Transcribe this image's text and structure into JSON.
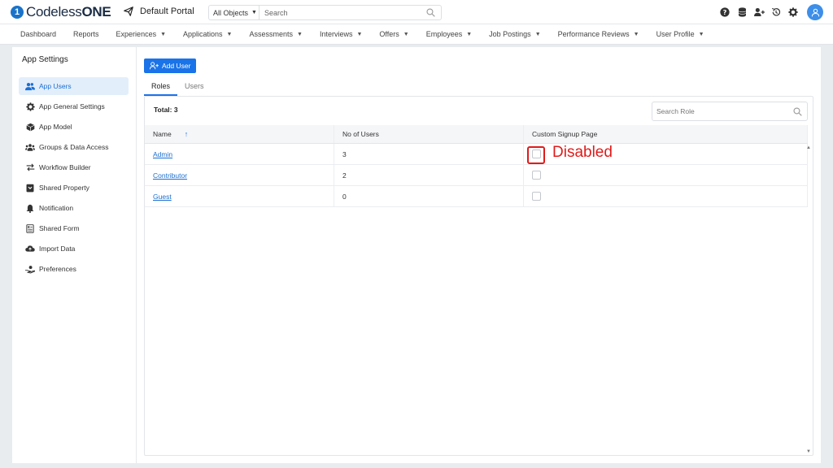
{
  "app": {
    "brand_prefix": "Codeless",
    "brand_suffix": "ONE",
    "portal_name": "Default Portal"
  },
  "search": {
    "object_scope": "All Objects",
    "placeholder": "Search"
  },
  "nav": {
    "items": [
      {
        "label": "Dashboard",
        "dropdown": false
      },
      {
        "label": "Reports",
        "dropdown": false
      },
      {
        "label": "Experiences",
        "dropdown": true
      },
      {
        "label": "Applications",
        "dropdown": true
      },
      {
        "label": "Assessments",
        "dropdown": true
      },
      {
        "label": "Interviews",
        "dropdown": true
      },
      {
        "label": "Offers",
        "dropdown": true
      },
      {
        "label": "Employees",
        "dropdown": true
      },
      {
        "label": "Job Postings",
        "dropdown": true
      },
      {
        "label": "Performance Reviews",
        "dropdown": true
      },
      {
        "label": "User Profile",
        "dropdown": true
      }
    ]
  },
  "sidebar": {
    "title": "App Settings",
    "items": [
      {
        "label": "App Users",
        "icon": "users-icon",
        "active": true
      },
      {
        "label": "App General Settings",
        "icon": "gear-icon",
        "active": false
      },
      {
        "label": "App Model",
        "icon": "cube-icon",
        "active": false
      },
      {
        "label": "Groups & Data Access",
        "icon": "group-icon",
        "active": false
      },
      {
        "label": "Workflow Builder",
        "icon": "exchange-icon",
        "active": false
      },
      {
        "label": "Shared Property",
        "icon": "shared-property-icon",
        "active": false
      },
      {
        "label": "Notification",
        "icon": "bell-icon",
        "active": false
      },
      {
        "label": "Shared Form",
        "icon": "form-icon",
        "active": false
      },
      {
        "label": "Import Data",
        "icon": "cloud-upload-icon",
        "active": false
      },
      {
        "label": "Preferences",
        "icon": "hand-user-icon",
        "active": false
      }
    ]
  },
  "main": {
    "add_user_label": "Add User",
    "tabs": [
      {
        "label": "Roles",
        "active": true
      },
      {
        "label": "Users",
        "active": false
      }
    ],
    "total_label": "Total: 3",
    "role_search_placeholder": "Search Role",
    "table": {
      "columns": [
        "Name",
        "No of Users",
        "Custom Signup Page"
      ],
      "rows": [
        {
          "name": "Admin",
          "users": "3",
          "custom_signup": false
        },
        {
          "name": "Contributor",
          "users": "2",
          "custom_signup": false
        },
        {
          "name": "Guest",
          "users": "0",
          "custom_signup": false
        }
      ]
    }
  },
  "annotation": {
    "label": "Disabled",
    "color": "#e01b1b"
  },
  "colors": {
    "accent": "#1a73e8",
    "brand": "#1a73c9"
  }
}
